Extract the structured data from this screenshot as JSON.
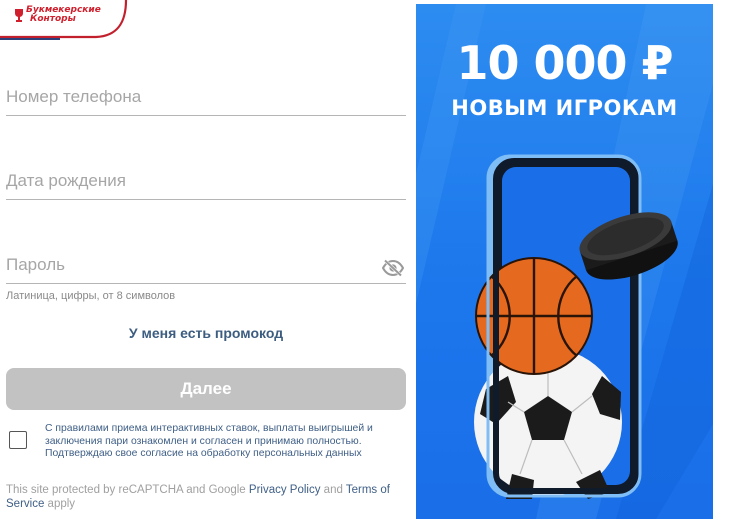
{
  "brand": {
    "logo_line1": "Букмекерские",
    "logo_line2": "Конторы"
  },
  "form": {
    "phone_placeholder": "Номер телефона",
    "birth_placeholder": "Дата рождения",
    "password_placeholder": "Пароль",
    "password_hint": "Латиница, цифры, от 8 символов",
    "promo_link": "У меня есть промокод",
    "next_button": "Далее",
    "agreement_text": "С правилами приема интерактивных ставок, выплаты выигрышей и заключения пари ознакомлен и согласен и принимаю полностью. Подтверждаю свое согласие на обработку персональных данных",
    "agreement_checked": false
  },
  "recaptcha": {
    "prefix": "This site protected by reCAPTCHA and Google ",
    "privacy": "Privacy Policy",
    "and": " and ",
    "terms": "Terms of Service",
    "suffix": " apply"
  },
  "banner": {
    "amount": "10 000 ₽",
    "subtitle": "НОВЫМ ИГРОКАМ"
  },
  "colors": {
    "accent_link": "#3f5f86",
    "disabled_button": "#c2c2c2",
    "banner_blue": "#1c77ec",
    "logo_red": "#d0202e"
  },
  "icons": {
    "eye": "eye-off-icon",
    "logo": "cup-icon"
  }
}
